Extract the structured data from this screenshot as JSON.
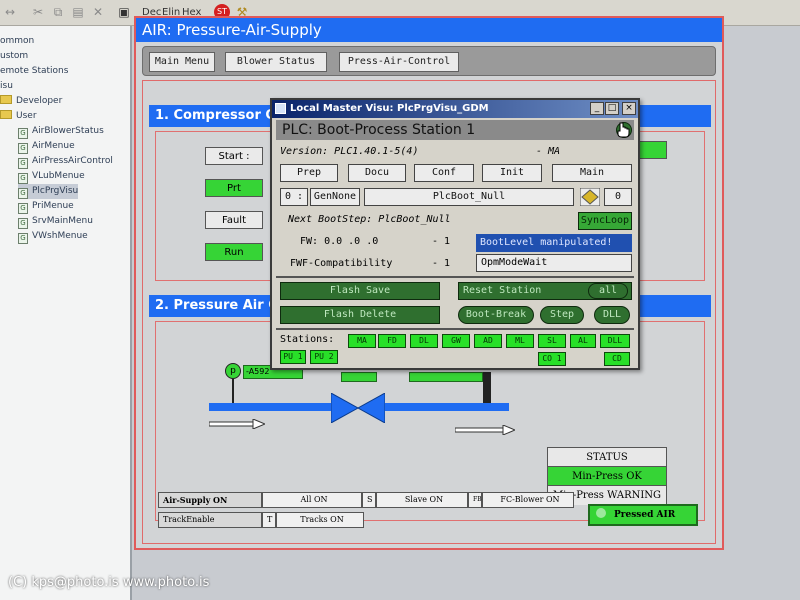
{
  "toolbar": {
    "dec": "Dec",
    "elin": "Elin",
    "hex": "Hex"
  },
  "tree": {
    "items": [
      {
        "label": "ommon",
        "kind": "folder"
      },
      {
        "label": "ustom",
        "kind": "folder"
      },
      {
        "label": "emote Stations",
        "kind": "folder"
      },
      {
        "label": "isu",
        "kind": "folder"
      },
      {
        "label": "Developer",
        "kind": "folder"
      },
      {
        "label": "User",
        "kind": "folder"
      },
      {
        "label": "AirBlowerStatus",
        "kind": "file"
      },
      {
        "label": "AirMenue",
        "kind": "file"
      },
      {
        "label": "AirPressAirControl",
        "kind": "file"
      },
      {
        "label": "VLubMenue",
        "kind": "file"
      },
      {
        "label": "PlcPrgVisu",
        "kind": "file"
      },
      {
        "label": "PriMenue",
        "kind": "file"
      },
      {
        "label": "SrvMainMenu",
        "kind": "file"
      },
      {
        "label": "VWshMenue",
        "kind": "file"
      }
    ]
  },
  "visu": {
    "title": "AIR: Pressure-Air-Supply",
    "nav": {
      "main": "Main Menu",
      "blower": "Blower Status",
      "press": "Press-Air-Control"
    },
    "section1": "1. Compressor C",
    "section2": "2. Pressure Air Co",
    "ops": {
      "start": "Start :",
      "prt": "Prt",
      "fault": "Fault",
      "run": "Run"
    },
    "gauge": {
      "p": "p",
      "tag": "-A592"
    },
    "status": {
      "header": "STATUS",
      "ok": "Min-Press OK",
      "warn": "Min-Press WARNING"
    },
    "bottom": {
      "air_supply": "Air-Supply ON",
      "all_on": "All ON",
      "s": "S",
      "slave": "Slave ON",
      "fb": "FB",
      "fc_blower": "FC-Blower ON",
      "track_enable": "TrackEnable",
      "t": "T",
      "tracks": "Tracks ON"
    },
    "pressed_air": "Pressed AIR"
  },
  "popup": {
    "title": "Local Master Visu: PlcPrgVisu_GDM",
    "win": {
      "min": "_",
      "max": "□",
      "close": "×"
    },
    "header": "PLC: Boot-Process  Station 1",
    "version_label": "Version: PLC1.40.1-5(4)",
    "ma_label": "-  MA",
    "buttons": {
      "prep": "Prep",
      "docu": "Docu",
      "conf": "Conf",
      "init": "Init",
      "main": "Main"
    },
    "row2": {
      "zero": "0 :",
      "gennone": "GenNone",
      "bootname": "PlcBoot_Null",
      "count": "0"
    },
    "next_step": "Next BootStep: PlcBoot_Null",
    "syncloop": "SyncLoop",
    "fw": "FW: 0.0  .0  .0",
    "fw_val": "- 1",
    "fwf": "FWF-Compatibility",
    "fwf_val": "- 1",
    "bootlevel": "BootLevel manipulated!",
    "opmode": "OpmModeWait",
    "flash_save": "Flash Save",
    "flash_delete": "Flash Delete",
    "reset_station": "Reset Station",
    "all": "all",
    "boot_break": "Boot-Break",
    "step": "Step",
    "dll": "DLL",
    "stations_label": "Stations:",
    "stations": [
      "MA",
      "FD",
      "DL",
      "GW",
      "AD",
      "ML",
      "SL",
      "AL",
      "DLL"
    ],
    "stations_row2": [
      "PU 1",
      "PU 2"
    ],
    "co1": "CO 1",
    "cd": "CD"
  },
  "watermark": "(C) kps@photo.is   www.photo.is",
  "colors": {
    "accent": "#1f6cf2",
    "green": "#36d436",
    "dark_green": "#2f6f2f"
  }
}
